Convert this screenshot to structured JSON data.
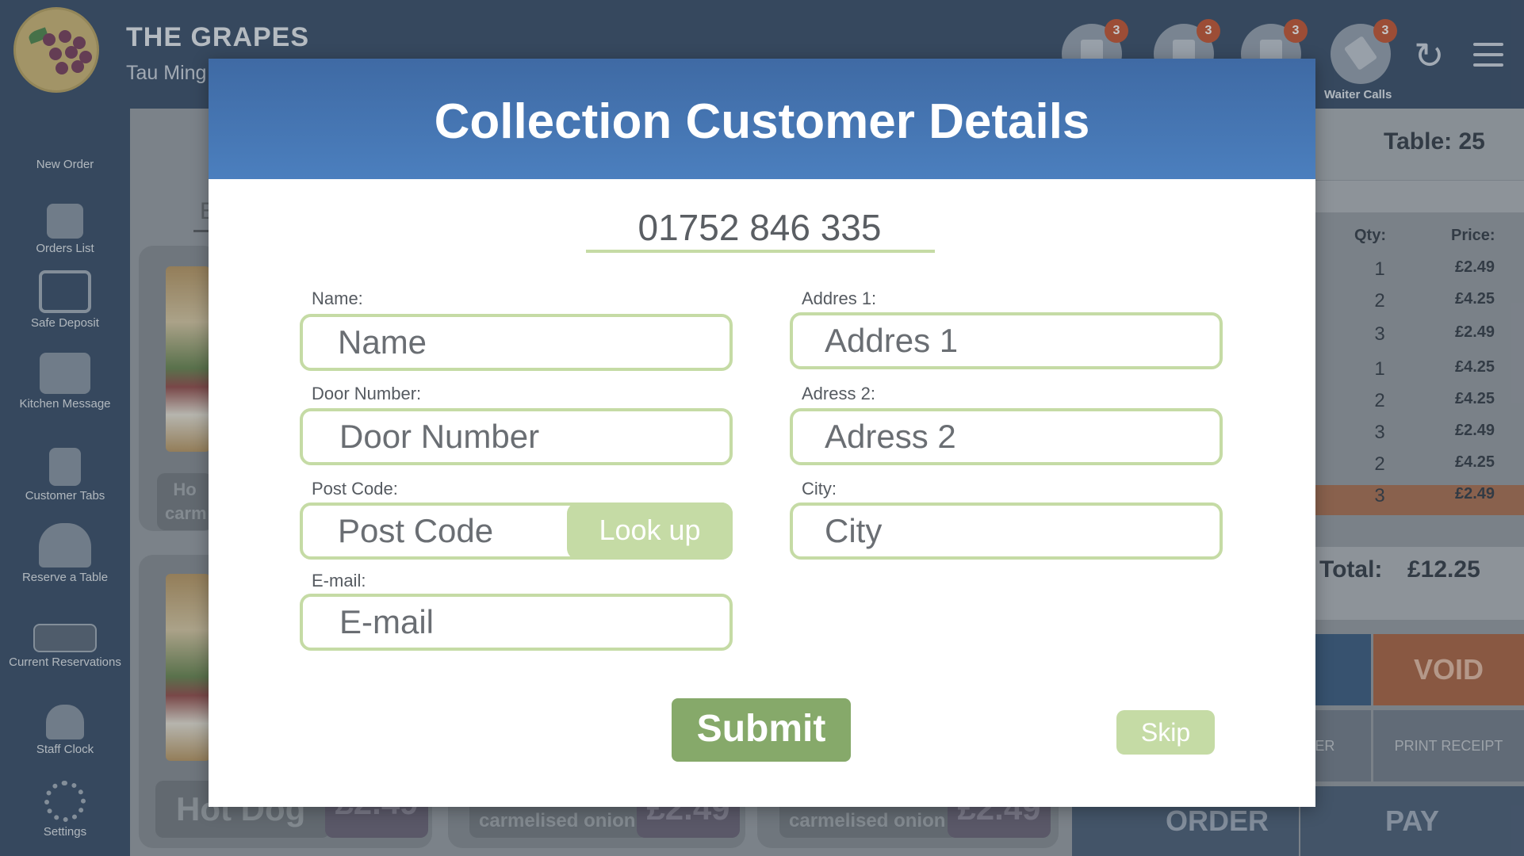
{
  "header": {
    "brand_name": "THE GRAPES",
    "brand_sub": "Tau Ming",
    "notifications": [
      {
        "icon": "clipboard-icon",
        "badge": "3"
      },
      {
        "icon": "plate-icon",
        "badge": "3"
      },
      {
        "icon": "receipt-icon",
        "badge": "3"
      },
      {
        "icon": "waiter-call-icon",
        "badge": "3",
        "label": "Waiter Calls"
      }
    ]
  },
  "sidebar": {
    "items": [
      {
        "label": "New Order"
      },
      {
        "label": "Orders List"
      },
      {
        "label": "Safe Deposit"
      },
      {
        "label": "Kitchen Message"
      },
      {
        "label": "Customer Tabs"
      },
      {
        "label": "Reserve a Table"
      },
      {
        "label": "Current Reservations"
      },
      {
        "label": "Staff Clock"
      },
      {
        "label": "Settings"
      }
    ]
  },
  "menu_tiles": {
    "tab_initial": "E",
    "tile_a_label": "Ho carm",
    "tile_b_label": "Hot Dog",
    "tile_b_price": "£2.49",
    "tile_c_label": "carmelised onion",
    "tile_c_price": "£2.49",
    "tile_d_label": "carmelised onion",
    "tile_d_price": "£2.49"
  },
  "order_panel": {
    "table": "Table: 25",
    "qty_header": "Qty:",
    "price_header": "Price:",
    "rows": [
      {
        "qty": "1",
        "price": "£2.49"
      },
      {
        "qty": "2",
        "price": "£4.25"
      },
      {
        "qty": "3",
        "price": "£2.49"
      },
      {
        "qty": "1",
        "price": "£4.25"
      },
      {
        "qty": "2",
        "price": "£4.25"
      },
      {
        "qty": "3",
        "price": "£2.49"
      },
      {
        "qty": "2",
        "price": "£4.25"
      },
      {
        "qty": "3",
        "price": "£2.49"
      }
    ],
    "total_label": "Total:",
    "total_value": "£12.25",
    "void": "VOID",
    "drawer": "AWER",
    "print_receipt": "PRINT RECEIPT",
    "order": "ORDER",
    "pay": "PAY",
    "minus": "-"
  },
  "modal": {
    "title": "Collection Customer Details",
    "phone": "01752 846 335",
    "name_label": "Name:",
    "name_placeholder": "Name",
    "door_label": "Door Number:",
    "door_placeholder": "Door Number",
    "postcode_label": "Post Code:",
    "postcode_placeholder": "Post Code",
    "lookup": "Look up",
    "email_label": "E-mail:",
    "email_placeholder": "E-mail",
    "addr1_label": "Addres 1:",
    "addr1_placeholder": "Addres 1",
    "addr2_label": "Adress 2:",
    "addr2_placeholder": "Adress 2",
    "city_label": "City:",
    "city_placeholder": "City",
    "submit": "Submit",
    "skip": "Skip"
  },
  "colors": {
    "header_blue": "#243b59",
    "modal_header": "#4b7fbe",
    "field_border": "#c5dba5",
    "submit_green": "#86a96a",
    "void_orange": "#c0431d"
  }
}
